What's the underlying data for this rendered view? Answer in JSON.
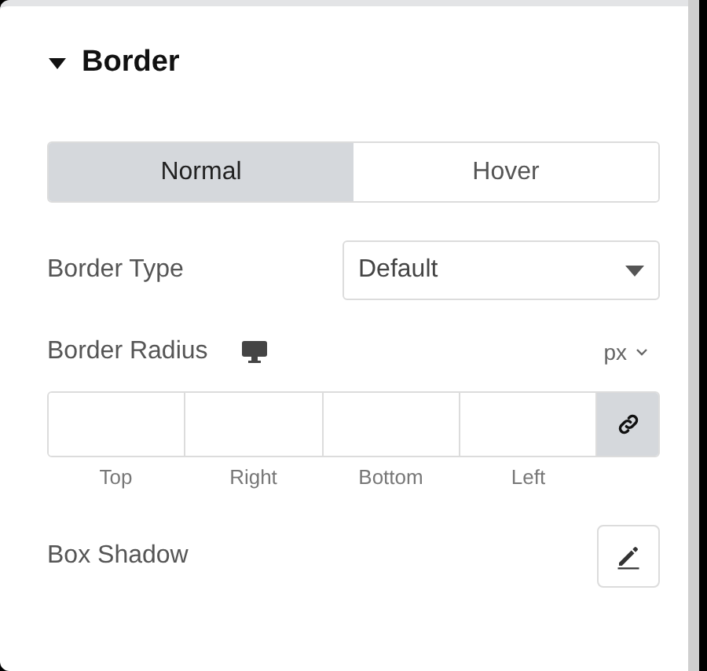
{
  "section": {
    "title": "Border",
    "expanded": true
  },
  "tabs": [
    {
      "label": "Normal",
      "selected": true
    },
    {
      "label": "Hover",
      "selected": false
    }
  ],
  "border_type": {
    "label": "Border Type",
    "value": "Default"
  },
  "border_radius": {
    "label": "Border Radius",
    "unit": "px",
    "linked": true,
    "sides": [
      "Top",
      "Right",
      "Bottom",
      "Left"
    ]
  },
  "box_shadow": {
    "label": "Box Shadow"
  }
}
